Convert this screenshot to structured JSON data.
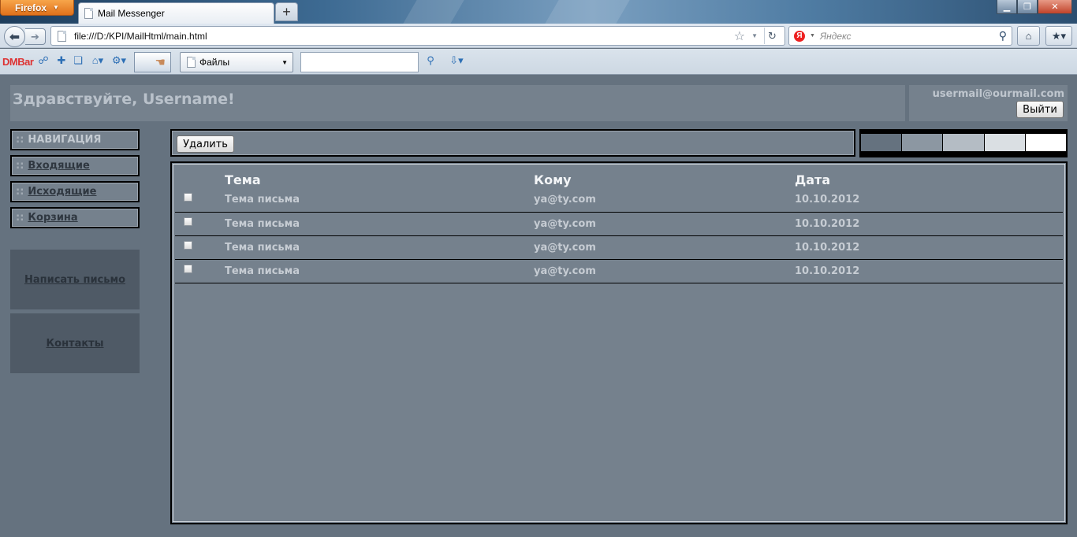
{
  "browser": {
    "menu_label": "Firefox",
    "tab_title": "Mail Messenger",
    "url": "file:///D:/KPI/MailHtml/main.html",
    "search_placeholder": "Яндекс",
    "bookmarks": {
      "dmbar_label": "DMBar",
      "files_select": "Файлы"
    }
  },
  "header": {
    "greeting": "Здравствуйте, Username!",
    "user_email": "usermail@ourmail.com",
    "logout_label": "Выйти"
  },
  "nav": {
    "title": "НАВИГАЦИЯ",
    "inbox": "Входящие",
    "outbox": "Исходящие",
    "trash": "Корзина",
    "compose": "Написать письмо",
    "contacts": "Контакты"
  },
  "toolbar": {
    "delete_label": "Удалить"
  },
  "palette": [
    "#65727f",
    "#8c97a2",
    "#b4bcc4",
    "#dadfe3",
    "#ffffff"
  ],
  "mail": {
    "columns": {
      "subject": "Тема",
      "to": "Кому",
      "date": "Дата"
    },
    "rows": [
      {
        "subject": "Тема письма",
        "to": "ya@ty.com",
        "date": "10.10.2012"
      },
      {
        "subject": "Тема письма",
        "to": "ya@ty.com",
        "date": "10.10.2012"
      },
      {
        "subject": "Тема письма",
        "to": "ya@ty.com",
        "date": "10.10.2012"
      },
      {
        "subject": "Тема письма",
        "to": "ya@ty.com",
        "date": "10.10.2012"
      }
    ]
  }
}
